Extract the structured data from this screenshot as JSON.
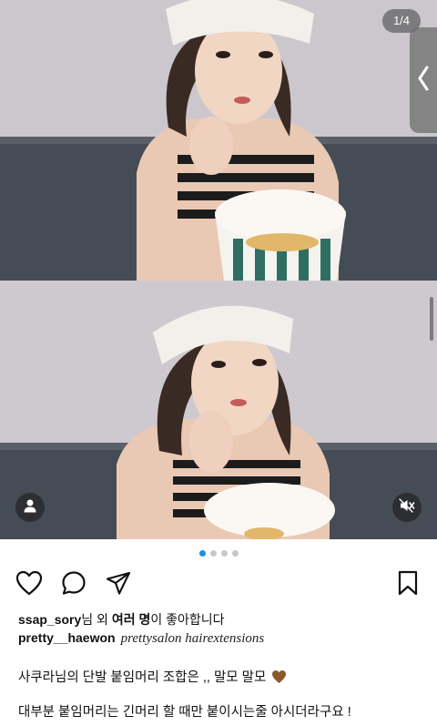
{
  "carousel": {
    "counter": "1/4",
    "active_index": 0,
    "total": 4
  },
  "icons": {
    "side_handle": "chevron-left-icon",
    "user": "user-icon",
    "mute": "speaker-muted-icon",
    "like": "heart-outline-icon",
    "comment": "speech-bubble-icon",
    "share": "paper-plane-icon",
    "save": "bookmark-outline-icon",
    "emoji": "brown-heart-emoji"
  },
  "likes": {
    "user": "ssap_sory",
    "text1": "님 외 ",
    "bold": "여러 명",
    "text2": "이 좋아합니다"
  },
  "caption": {
    "username": "pretty__haewon",
    "tags": "prettysalon hairextensions",
    "line1": "사쿠라님의 단발 붙임머리 조합은 ,, 말모 말모",
    "line2": "대부분 붙임머리는 긴머리 할 때만 붙이시는줄 아시더라구요 !"
  },
  "colors": {
    "active_dot": "#1d8ef0",
    "inactive_dot": "#c8c8c8",
    "emoji_heart": "#8a5a2b"
  }
}
